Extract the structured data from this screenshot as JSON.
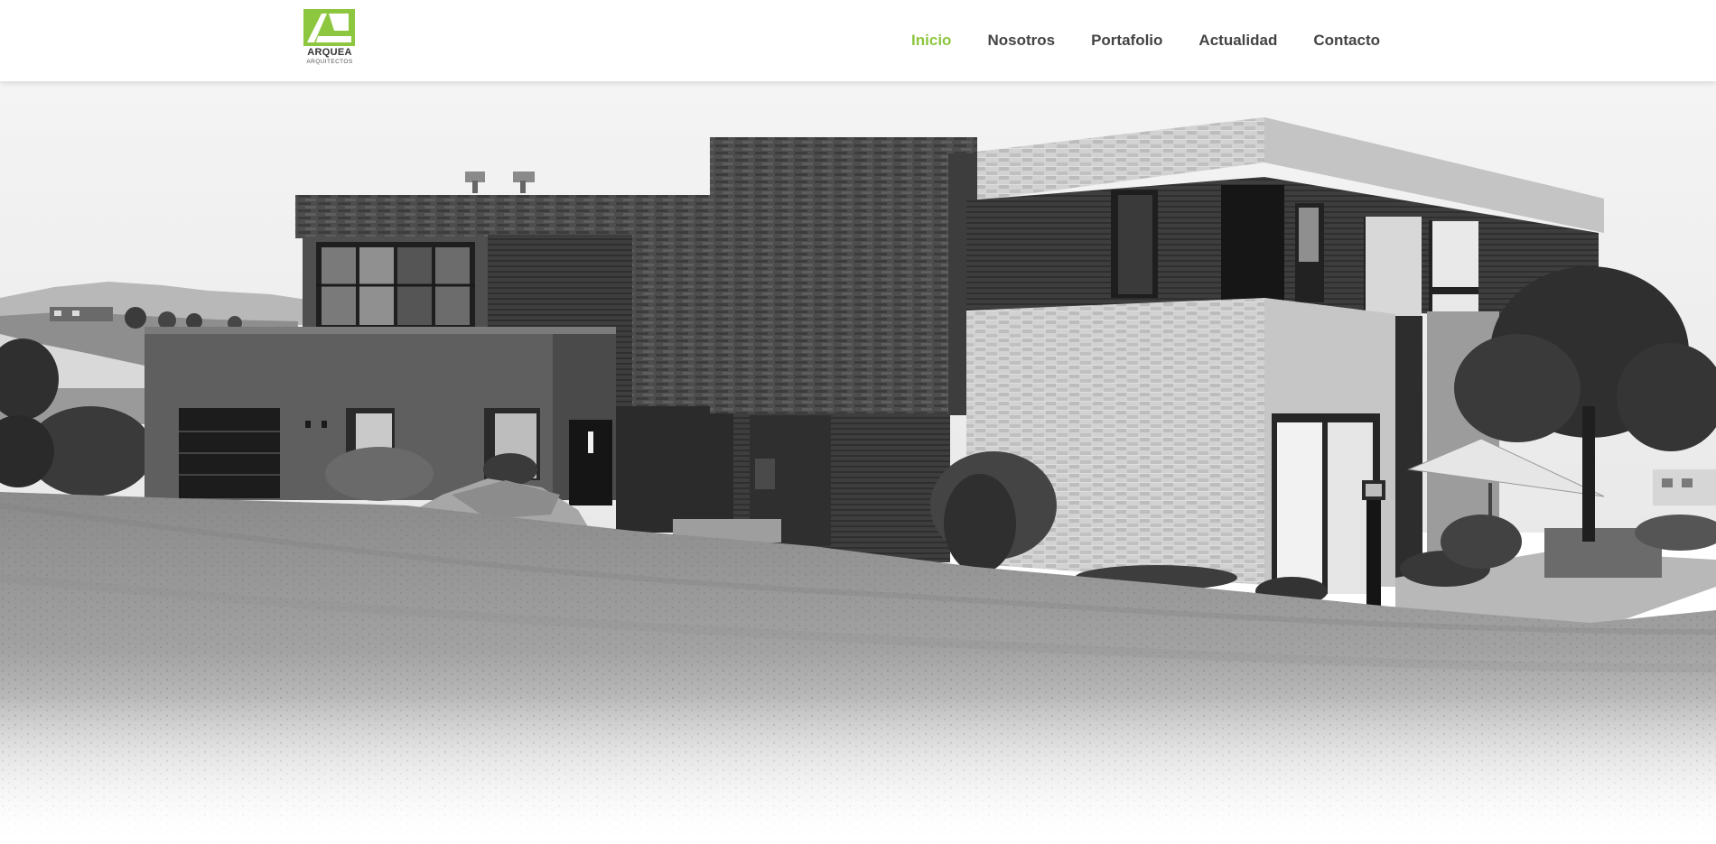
{
  "brand": {
    "name": "ARQUEA",
    "subtitle": "ARQUITECTOS",
    "accent_color": "#8dc63f",
    "logo_icon": "arquea-logo-icon"
  },
  "nav": {
    "items": [
      {
        "label": "Inicio",
        "active": true
      },
      {
        "label": "Nosotros",
        "active": false
      },
      {
        "label": "Portafolio",
        "active": false
      },
      {
        "label": "Actualidad",
        "active": false
      },
      {
        "label": "Contacto",
        "active": false
      }
    ]
  },
  "hero": {
    "image": "black-and-white photo of modern stone and brick house on a lawn"
  }
}
